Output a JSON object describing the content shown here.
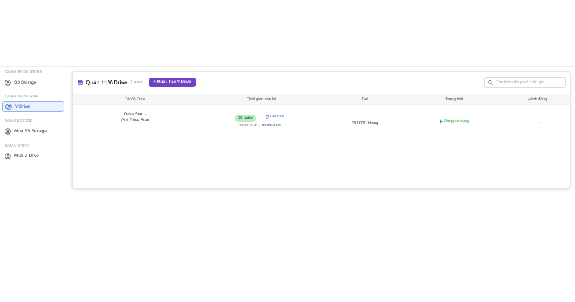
{
  "sidebar": {
    "sections": [
      {
        "title": "QUẢN TRỊ S3 STORE",
        "items": [
          {
            "label": "S3 Storage",
            "icon": "user-circle-icon",
            "active": false
          }
        ]
      },
      {
        "title": "QUẢN TRỊ V-DRIVE",
        "items": [
          {
            "label": "V-Drive",
            "icon": "user-circle-icon",
            "active": true
          }
        ]
      },
      {
        "title": "MUA S3 STORE",
        "items": [
          {
            "label": "Mua S3 Storage",
            "icon": "user-circle-icon",
            "active": false
          }
        ]
      },
      {
        "title": "MUA V-DRIVE",
        "items": [
          {
            "label": "Mua V-Drive",
            "icon": "user-circle-icon",
            "active": false
          }
        ]
      }
    ]
  },
  "card": {
    "title": "Quản trị V-Drive",
    "count": "(1 pack)",
    "buy_button": "+ Mua / Tạo V-Drive",
    "search_placeholder": "Tìm kiếm tên pack / tên gói",
    "columns": [
      "Tên V-Drive",
      "Thời gian còn lại",
      "Gói",
      "Trạng thái",
      "Hành động"
    ],
    "rows": [
      {
        "name_line1": "Drive Start -",
        "name_line2": "Gói: Drive Start",
        "remaining": "26 ngày",
        "renew": "Gia hạn",
        "dates": "19/08/2026 - 18/09/2026",
        "plan": "29,000/1 tháng",
        "status": "Đang sử dụng",
        "action": "···"
      }
    ]
  },
  "colors": {
    "accent": "#6f42c1",
    "active_bg": "#eaf2ff",
    "active_border": "#8fb4ea",
    "status_green": "#2aa84a",
    "link_blue": "#2c6fd1",
    "badge_bg": "#b9ecc6"
  }
}
